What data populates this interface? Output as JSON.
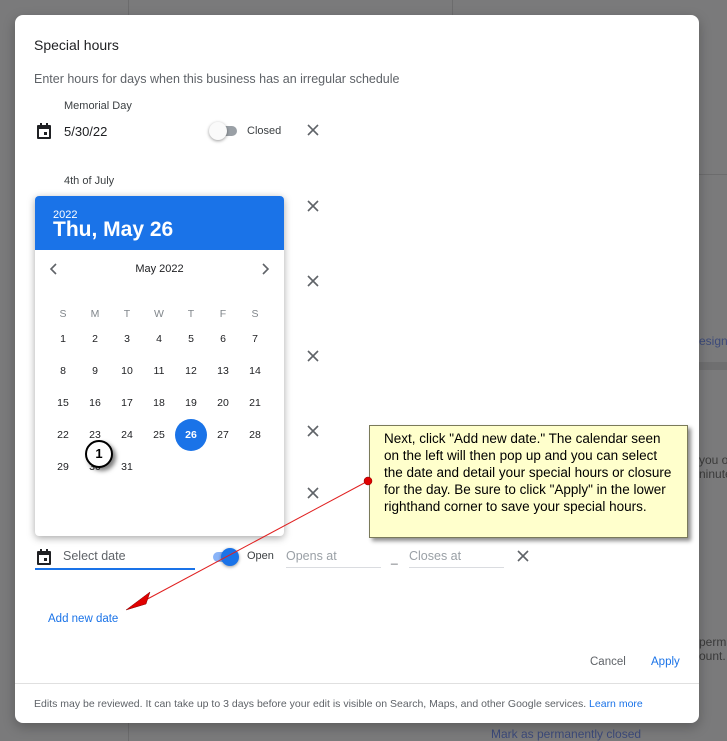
{
  "background": {
    "fragments": [
      "esign",
      "you o",
      "ninute",
      "perma",
      "ount.",
      "Mark as permanently closed"
    ]
  },
  "dialog": {
    "title": "Special hours",
    "subtitle": "Enter hours for days when this business has an irregular schedule",
    "entries": [
      {
        "label": "Memorial Day",
        "date": "5/30/22",
        "status": "Closed",
        "is_open": false
      },
      {
        "label": "4th of July"
      }
    ],
    "new_entry": {
      "date_placeholder": "Select date",
      "status": "Open",
      "is_open": true,
      "opens_placeholder": "Opens at",
      "separator": "–",
      "closes_placeholder": "Closes at"
    },
    "add_new_date": "Add new date",
    "cancel": "Cancel",
    "apply": "Apply",
    "footer_text": "Edits may be reviewed. It can take up to 3 days before your edit is visible on Search, Maps, and other Google services.",
    "learn_more": "Learn more",
    "accent_color": "#1a73e8"
  },
  "calendar": {
    "year": "2022",
    "selected_date_label": "Thu, May 26",
    "month_label": "May 2022",
    "prev_icon": "chevron-left-icon",
    "next_icon": "chevron-right-icon",
    "weekdays": [
      "S",
      "M",
      "T",
      "W",
      "T",
      "F",
      "S"
    ],
    "weeks": [
      [
        "1",
        "2",
        "3",
        "4",
        "5",
        "6",
        "7"
      ],
      [
        "8",
        "9",
        "10",
        "11",
        "12",
        "13",
        "14"
      ],
      [
        "15",
        "16",
        "17",
        "18",
        "19",
        "20",
        "21"
      ],
      [
        "22",
        "23",
        "24",
        "25",
        "26",
        "27",
        "28"
      ],
      [
        "29",
        "30",
        "31",
        "",
        "",
        "",
        ""
      ]
    ],
    "selected_day": "26"
  },
  "annotation": {
    "step_number": "1",
    "callout_text": "Next, click \"Add new date.\" The calendar seen on the left will then pop up and you can select the date and detail your special hours or closure for the day.  Be sure to click \"Apply\" in the lower righthand corner to save your special hours."
  }
}
